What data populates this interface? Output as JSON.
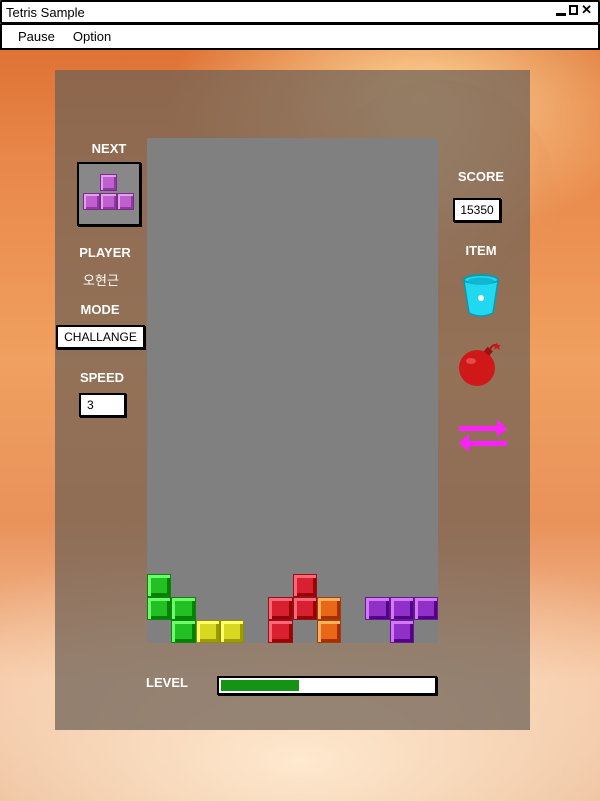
{
  "window": {
    "title": "Tetris Sample"
  },
  "menu": {
    "items": [
      "Pause",
      "Option"
    ]
  },
  "left": {
    "next_label": "NEXT",
    "player_label": "PLAYER",
    "player_name": "오현근",
    "mode_label": "MODE",
    "mode_value": "CHALLANGE",
    "speed_label": "SPEED",
    "speed_value": "3"
  },
  "right": {
    "score_label": "SCORE",
    "score_value": "15350",
    "item_label": "ITEM",
    "items": [
      "bucket-icon",
      "bomb-icon",
      "swap-arrows-icon"
    ]
  },
  "level": {
    "label": "LEVEL",
    "progress": 0.36
  },
  "next_piece": {
    "type": "T",
    "color": "#c060d0"
  },
  "board": {
    "cols": 12,
    "rows": 22,
    "cells": [
      {
        "col": 0,
        "row": 19,
        "color": "#22c022"
      },
      {
        "col": 0,
        "row": 20,
        "color": "#22c022"
      },
      {
        "col": 1,
        "row": 20,
        "color": "#22c022"
      },
      {
        "col": 1,
        "row": 21,
        "color": "#22c022"
      },
      {
        "col": 2,
        "row": 21,
        "color": "#d8d820"
      },
      {
        "col": 3,
        "row": 21,
        "color": "#d8d820"
      },
      {
        "col": 5,
        "row": 20,
        "color": "#d82030"
      },
      {
        "col": 5,
        "row": 21,
        "color": "#d82030"
      },
      {
        "col": 6,
        "row": 19,
        "color": "#d82030"
      },
      {
        "col": 6,
        "row": 20,
        "color": "#d82030"
      },
      {
        "col": 7,
        "row": 20,
        "color": "#e86818"
      },
      {
        "col": 7,
        "row": 21,
        "color": "#e86818"
      },
      {
        "col": 9,
        "row": 20,
        "color": "#9030c8"
      },
      {
        "col": 10,
        "row": 20,
        "color": "#9030c8"
      },
      {
        "col": 11,
        "row": 20,
        "color": "#9030c8"
      },
      {
        "col": 10,
        "row": 21,
        "color": "#9030c8"
      }
    ]
  },
  "colors": {
    "item_cyan": "#20d8f0",
    "item_red": "#d01818",
    "item_magenta": "#ff20ff",
    "level_fill": "#149414"
  }
}
